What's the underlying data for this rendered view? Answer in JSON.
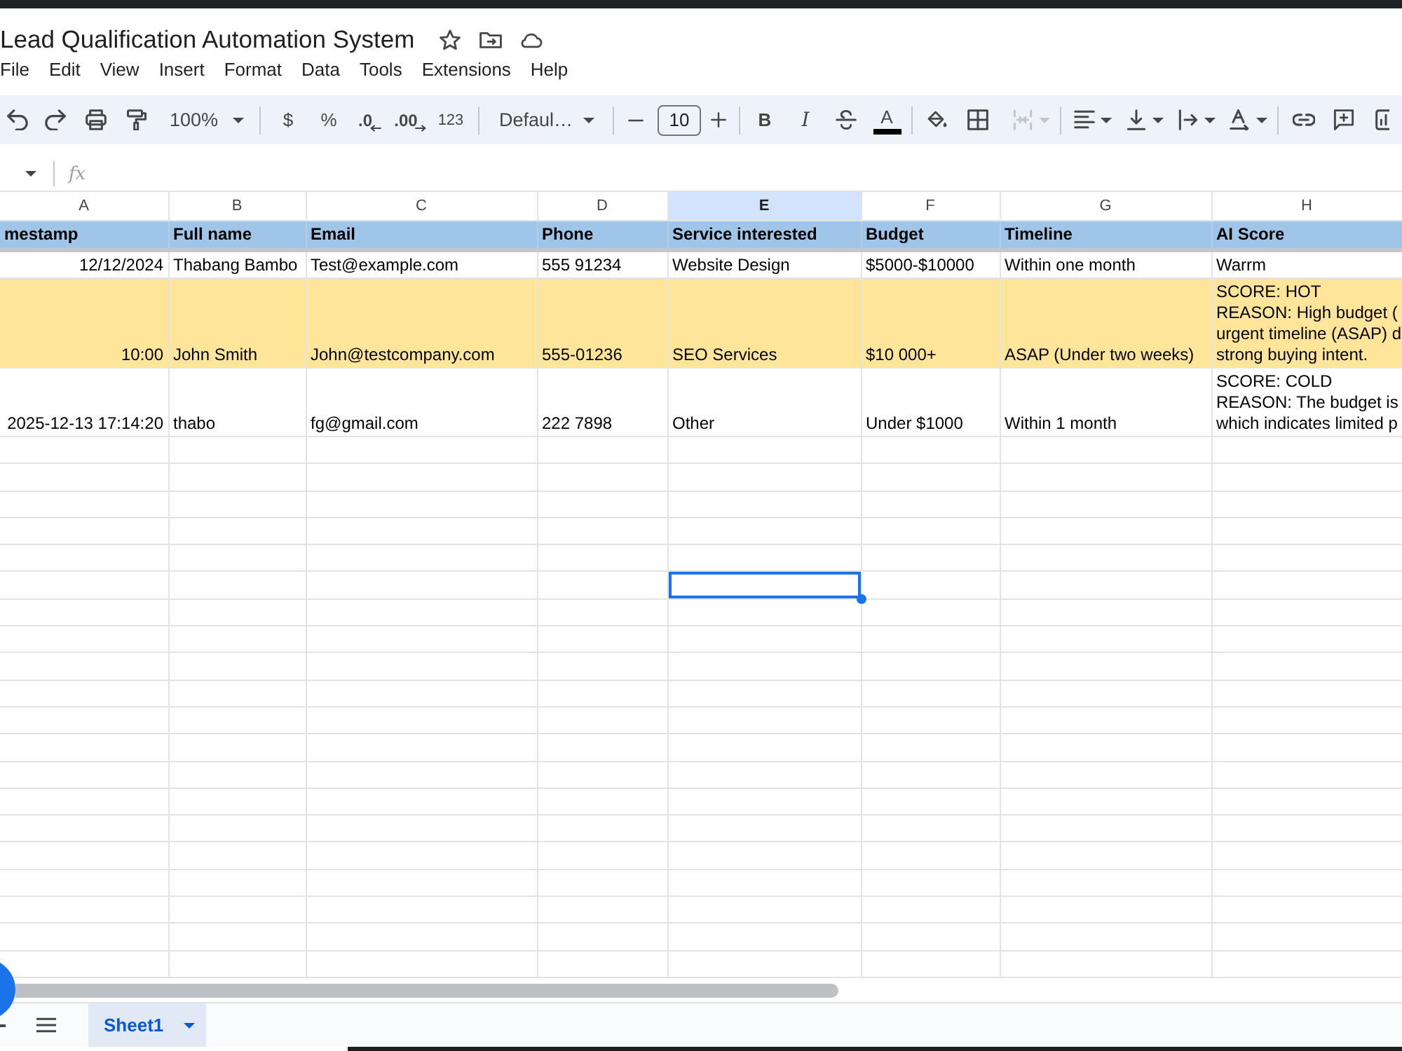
{
  "window": {
    "title": "Lead Qualification Automation System"
  },
  "menu": [
    "File",
    "Edit",
    "View",
    "Insert",
    "Format",
    "Data",
    "Tools",
    "Extensions",
    "Help"
  ],
  "toolbar": {
    "zoom": "100%",
    "currency": "$",
    "percent": "%",
    "decrease_decimal": ".0",
    "increase_decimal": ".00",
    "number_formats": "123",
    "font": "Defaul…",
    "font_size": "10",
    "bold": "B",
    "italic": "I",
    "text_color": "A",
    "merge_cells": {
      "disabled": true
    }
  },
  "formula_bar": {
    "label": "fx"
  },
  "sheet": {
    "columns": [
      {
        "letter": "A",
        "kind": "date",
        "selected": false
      },
      {
        "letter": "B",
        "kind": "text",
        "selected": false
      },
      {
        "letter": "C",
        "kind": "text",
        "selected": false
      },
      {
        "letter": "D",
        "kind": "text",
        "selected": false
      },
      {
        "letter": "E",
        "kind": "text",
        "selected": true
      },
      {
        "letter": "F",
        "kind": "text",
        "selected": false
      },
      {
        "letter": "G",
        "kind": "text",
        "selected": false
      },
      {
        "letter": "H",
        "kind": "text",
        "selected": false
      }
    ],
    "header_row": [
      "mestamp",
      "Full name",
      "Email",
      "Phone",
      "Service interested",
      "Budget",
      "Timeline",
      "AI Score"
    ],
    "rows": [
      {
        "highlighted": false,
        "cells": [
          "12/12/2024",
          "Thabang Bambo",
          "Test@example.com",
          "555 91234",
          "Website Design",
          "$5000-$10000",
          "Within one month",
          "Warrm"
        ]
      },
      {
        "highlighted": true,
        "cells": [
          "10:00",
          "John Smith",
          "John@testcompany.com",
          "555-01236",
          "SEO Services",
          "$10 000+",
          "ASAP (Under two weeks)",
          "SCORE: HOT\nREASON: High budget (\nurgent timeline (ASAP) d\nstrong buying intent."
        ]
      },
      {
        "highlighted": false,
        "cells": [
          "2025-12-13 17:14:20",
          "thabo",
          "fg@gmail.com",
          "222 7898",
          "Other",
          "Under $1000",
          "Within 1 month",
          "SCORE: COLD\nREASON: The budget is\nwhich indicates limited p"
        ]
      }
    ],
    "blank_rows": [
      {
        "selected": false
      },
      {
        "selected": false
      },
      {
        "selected": false
      },
      {
        "selected": false
      },
      {
        "selected": false
      },
      {
        "selected": true
      },
      {
        "selected": false
      },
      {
        "selected": false
      },
      {
        "selected": false
      },
      {
        "selected": false
      },
      {
        "selected": false
      },
      {
        "selected": false
      },
      {
        "selected": false
      },
      {
        "selected": false
      },
      {
        "selected": false
      },
      {
        "selected": false
      },
      {
        "selected": false
      },
      {
        "selected": false
      },
      {
        "selected": false
      },
      {
        "selected": false
      }
    ]
  },
  "sheet_tabs": [
    {
      "label": "Sheet1",
      "selected": true
    }
  ]
}
